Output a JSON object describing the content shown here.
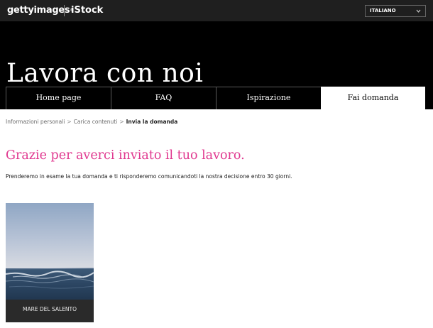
{
  "topbar": {
    "logo_getty": "gettyimages",
    "logo_getty_mark": "®",
    "logo_istock": "iStock",
    "language": "ITALIANO",
    "language_icon": "chevron-down-icon"
  },
  "header": {
    "title": "Lavora con noi"
  },
  "nav": {
    "items": [
      {
        "label": "Home page"
      },
      {
        "label": "FAQ"
      },
      {
        "label": "Ispirazione"
      },
      {
        "label": "Fai domanda"
      }
    ],
    "active_index": 3
  },
  "breadcrumb": {
    "steps": [
      "Informazioni personali",
      "Carica contenuti",
      "Invia la domanda"
    ],
    "separator": ">"
  },
  "main": {
    "heading": "Grazie per averci inviato il tuo lavoro.",
    "description": "Prenderemo in esame la tua domanda e ti risponderemo comunicandoti la nostra decisione entro 30 giorni."
  },
  "submission": {
    "caption": "MARE DEL SALENTO"
  },
  "colors": {
    "accent": "#e0388f",
    "header_bg": "#000000",
    "topbar_bg": "#1f1f1f"
  }
}
